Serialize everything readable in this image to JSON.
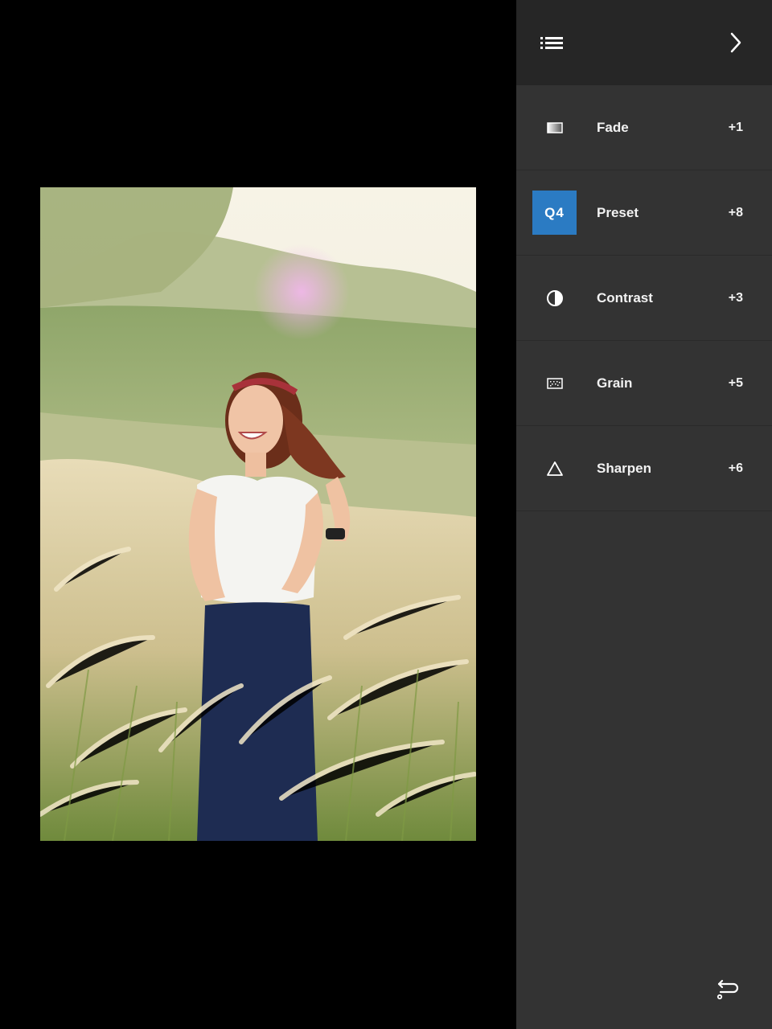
{
  "header": {
    "menu_icon": "list-icon",
    "next_icon": "chevron-right-icon"
  },
  "tools": [
    {
      "label": "Fade",
      "value": "+1",
      "icon": "fade-icon"
    },
    {
      "label": "Preset",
      "value": "+8",
      "icon": "preset-badge",
      "badge_text": "Q4",
      "badge_color": "#2b7bc3"
    },
    {
      "label": "Contrast",
      "value": "+3",
      "icon": "contrast-icon"
    },
    {
      "label": "Grain",
      "value": "+5",
      "icon": "grain-icon"
    },
    {
      "label": "Sharpen",
      "value": "+6",
      "icon": "sharpen-icon"
    }
  ],
  "footer": {
    "undo_icon": "undo-icon"
  },
  "colors": {
    "panel_bg": "#333333",
    "header_bg": "#262626",
    "accent": "#2b7bc3"
  }
}
